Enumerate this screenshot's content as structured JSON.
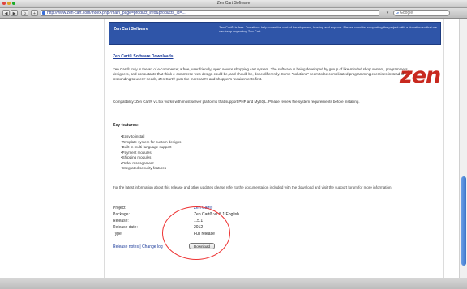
{
  "window": {
    "title": "Zen Cart Software"
  },
  "toolbar": {
    "back_label": "◀",
    "forward_label": "▶",
    "reload_label": "↻",
    "add_label": "+",
    "url": "http://www.zen-cart.com/index.php?main_page=product_info&products_id=...",
    "search_placeholder": "Google",
    "search_glyph": "G",
    "caret_glyph": "▾"
  },
  "banner": {
    "title": "Zen Cart Software",
    "copy": "Zen Cart® is free. Donations help cover the cost of development, hosting and support. Please consider supporting the project with a donation so that we can keep improving Zen Cart."
  },
  "logo": {
    "text": "zen"
  },
  "page": {
    "heading": "Zen Cart® Software Downloads",
    "intro": "Zen Cart® truly is the art of e-commerce; a free, user-friendly, open source shopping cart system. The software is being developed by group of like-minded shop owners, programmers, designers, and consultants that think e-commerce web design could be, and should be, done differently. Some \"solutions\" seem to be complicated programming exercises instead of responding to users' needs, Zen Cart® puts the merchant's and shopper's requirements first.",
    "compat": "Compatibility: Zen Cart® v1.5.x works with most server platforms that support PHP and MySQL. Please review the system requirements before installing.",
    "features_heading": "Key features:",
    "features": [
      "Easy to install",
      "Template system for custom designs",
      "Built-in multi-language support",
      "Payment modules",
      "Shipping modules",
      "Order management",
      "Integrated security features"
    ],
    "note": "For the latest information about this release and other updates please refer to the documentation included with the download and visit the support forum for more information."
  },
  "info": {
    "rows": [
      {
        "label": "Project:",
        "value": "Zen Cart®",
        "link": true
      },
      {
        "label": "Package:",
        "value": "Zen Cart® v1.5.1 English",
        "link": false
      },
      {
        "label": "Release:",
        "value": "1.5.1",
        "link": false
      },
      {
        "label": "Release date:",
        "value": "2012",
        "link": false
      },
      {
        "label": "Type:",
        "value": "Full release",
        "link": false
      }
    ]
  },
  "links": {
    "left_label": "Release notes",
    "separator": "|",
    "right_label": "Change log",
    "download_label": "Download"
  },
  "colors": {
    "banner": "#2f55a8",
    "logo": "#c8281e",
    "annotation": "#e33333",
    "link": "#1a3a9a"
  }
}
